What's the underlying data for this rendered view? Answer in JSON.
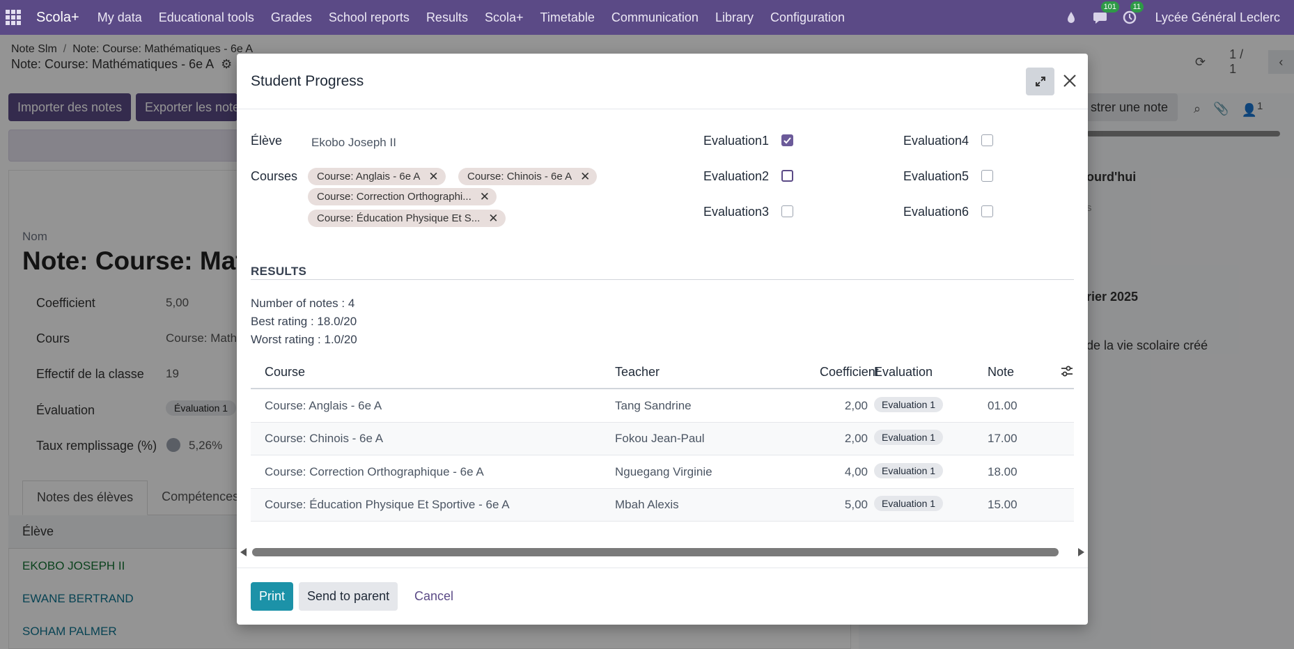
{
  "navbar": {
    "brand": "Scola+",
    "menu": [
      "My data",
      "Educational tools",
      "Grades",
      "School reports",
      "Results",
      "Scola+",
      "Timetable",
      "Communication",
      "Library",
      "Configuration"
    ],
    "messages_count": "101",
    "activities_count": "11",
    "company": "Lycée Général Leclerc"
  },
  "background": {
    "breadcrumb_root": "Note Slm",
    "breadcrumb_current": "Note: Course: Mathématiques - 6e A",
    "subtitle": "Note: Course: Mathématiques - 6e A",
    "pager": "1 / 1",
    "import_button": "Importer des notes",
    "export_button": "Exporter les note",
    "log_button": "strer une note",
    "nom_label": "Nom",
    "nom_title": "Note: Course: Math",
    "fields": [
      {
        "label": "Coefficient",
        "value": "5,00"
      },
      {
        "label": "Cours",
        "value": "Course: Math"
      },
      {
        "label": "Effectif de la classe",
        "value": "19"
      },
      {
        "label": "Évaluation",
        "value": "Évaluation 1"
      },
      {
        "label": "Taux remplissage (%)",
        "value": "5,26%"
      }
    ],
    "tabs": [
      "Notes des élèves",
      "Compétences"
    ],
    "table_header": "Élève",
    "students": [
      "EKOBO JOSEPH II",
      "EWANE BERTRAND",
      "SOHAM PALMER"
    ],
    "chatter": {
      "today": "ourd'hui",
      "muted": "s",
      "date": "rier 2025",
      "message": "de la vie scolaire créé",
      "followers": "1"
    }
  },
  "modal": {
    "title": "Student Progress",
    "student_label": "Élève",
    "student_value": "Ekobo Joseph II",
    "courses_label": "Courses",
    "course_tags": [
      "Course: Anglais - 6e A",
      "Course: Chinois - 6e A",
      "Course: Correction Orthographi...",
      "Course: Éducation Physique Et S..."
    ],
    "evaluations": [
      {
        "label": "Evaluation1",
        "checked": true
      },
      {
        "label": "Evaluation2",
        "checked": false
      },
      {
        "label": "Evaluation3",
        "checked": false
      },
      {
        "label": "Evaluation4",
        "checked": false
      },
      {
        "label": "Evaluation5",
        "checked": false
      },
      {
        "label": "Evaluation6",
        "checked": false
      }
    ],
    "results_title": "RESULTS",
    "stats": {
      "count": "Number of notes : 4",
      "best": "Best rating : 18.0/20",
      "worst": "Worst rating : 1.0/20"
    },
    "table": {
      "headers": [
        "Course",
        "Teacher",
        "Coefficient",
        "Evaluation",
        "Note"
      ],
      "rows": [
        {
          "course": "Course: Anglais - 6e A",
          "teacher": "Tang Sandrine",
          "coefficient": "2,00",
          "evaluation": "Evaluation 1",
          "note": "01.00"
        },
        {
          "course": "Course: Chinois - 6e A",
          "teacher": "Fokou Jean-Paul",
          "coefficient": "2,00",
          "evaluation": "Evaluation 1",
          "note": "17.00"
        },
        {
          "course": "Course: Correction Orthographique - 6e A",
          "teacher": "Nguegang Virginie",
          "coefficient": "4,00",
          "evaluation": "Evaluation 1",
          "note": "18.00"
        },
        {
          "course": "Course: Éducation Physique Et Sportive - 6e A",
          "teacher": "Mbah Alexis",
          "coefficient": "5,00",
          "evaluation": "Evaluation 1",
          "note": "15.00"
        }
      ]
    },
    "footer": {
      "print": "Print",
      "send": "Send to parent",
      "cancel": "Cancel"
    }
  },
  "colors": {
    "navbar": "#5b4a86",
    "primary": "#1c92a8",
    "tag": "#e8dedc",
    "checkbox_checked": "#6b5a99"
  }
}
